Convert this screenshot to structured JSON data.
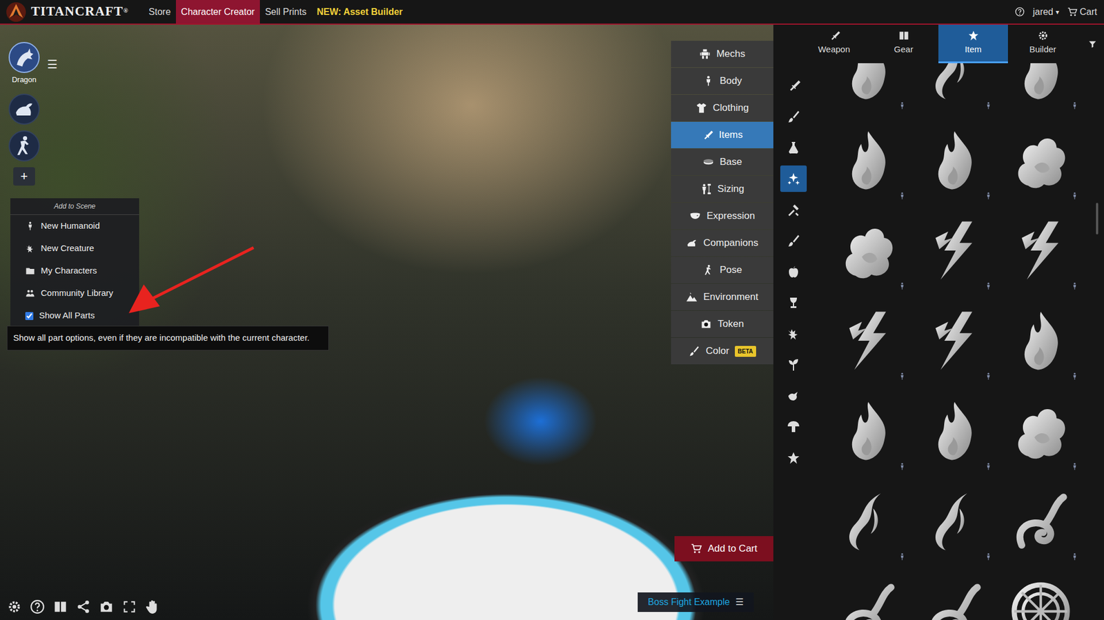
{
  "navbar": {
    "logo": "TITANCRAFT",
    "logo_mark": "®",
    "links": [
      {
        "label": "Store",
        "selected": false,
        "kind": "link"
      },
      {
        "label": "Character Creator",
        "selected": true,
        "kind": "link"
      },
      {
        "label": "Sell Prints",
        "selected": false,
        "kind": "link"
      },
      {
        "label": "NEW: Asset Builder",
        "selected": false,
        "kind": "promo"
      }
    ],
    "user": "jared",
    "user_caret": "▾",
    "cart": "Cart"
  },
  "scene": {
    "characters": [
      {
        "label": "Dragon",
        "selected": true,
        "kind": "dragon"
      },
      {
        "label": "",
        "selected": false,
        "kind": "beast"
      },
      {
        "label": "",
        "selected": false,
        "kind": "humanoid"
      }
    ],
    "add_button": "+",
    "menu_button": "☰"
  },
  "add_to_scene": {
    "title": "Add to Scene",
    "items": [
      "New Humanoid",
      "New Creature",
      "My Characters",
      "Community Library"
    ],
    "show_all_parts": {
      "label": "Show All Parts",
      "checked": true
    }
  },
  "tooltip": "Show all part options, even if they are incompatible with the current character.",
  "categories": [
    {
      "label": "Mechs",
      "selected": false,
      "badge": ""
    },
    {
      "label": "Body",
      "selected": false,
      "badge": ""
    },
    {
      "label": "Clothing",
      "selected": false,
      "badge": ""
    },
    {
      "label": "Items",
      "selected": true,
      "badge": ""
    },
    {
      "label": "Base",
      "selected": false,
      "badge": ""
    },
    {
      "label": "Sizing",
      "selected": false,
      "badge": ""
    },
    {
      "label": "Expression",
      "selected": false,
      "badge": ""
    },
    {
      "label": "Companions",
      "selected": false,
      "badge": ""
    },
    {
      "label": "Pose",
      "selected": false,
      "badge": ""
    },
    {
      "label": "Environment",
      "selected": false,
      "badge": ""
    },
    {
      "label": "Token",
      "selected": false,
      "badge": ""
    },
    {
      "label": "Color",
      "selected": false,
      "badge": "BETA"
    }
  ],
  "add_to_cart": "Add to Cart",
  "scene_name": {
    "label": "Boss Fight Example",
    "menu": "☰"
  },
  "panel": {
    "tabs": [
      {
        "label": "Weapon",
        "selected": false
      },
      {
        "label": "Gear",
        "selected": false
      },
      {
        "label": "Item",
        "selected": true
      },
      {
        "label": "Builder",
        "selected": false
      }
    ],
    "rail": [
      {
        "selected": false
      },
      {
        "selected": false
      },
      {
        "selected": false
      },
      {
        "selected": true
      },
      {
        "selected": false
      },
      {
        "selected": false
      },
      {
        "selected": false
      },
      {
        "selected": false
      },
      {
        "selected": false
      },
      {
        "selected": false
      },
      {
        "selected": false
      },
      {
        "selected": false
      },
      {
        "selected": false
      }
    ],
    "items": [
      {
        "kind": "flame"
      },
      {
        "kind": "wisp"
      },
      {
        "kind": "flame"
      },
      {
        "kind": "flame"
      },
      {
        "kind": "flame"
      },
      {
        "kind": "smoke"
      },
      {
        "kind": "smoke"
      },
      {
        "kind": "bolt"
      },
      {
        "kind": "bolt"
      },
      {
        "kind": "bolt"
      },
      {
        "kind": "bolt"
      },
      {
        "kind": "flame"
      },
      {
        "kind": "flame"
      },
      {
        "kind": "flame"
      },
      {
        "kind": "smoke"
      },
      {
        "kind": "wisp"
      },
      {
        "kind": "wisp"
      },
      {
        "kind": "swirl"
      },
      {
        "kind": "swirl"
      },
      {
        "kind": "swirl"
      },
      {
        "kind": "rune"
      }
    ]
  }
}
